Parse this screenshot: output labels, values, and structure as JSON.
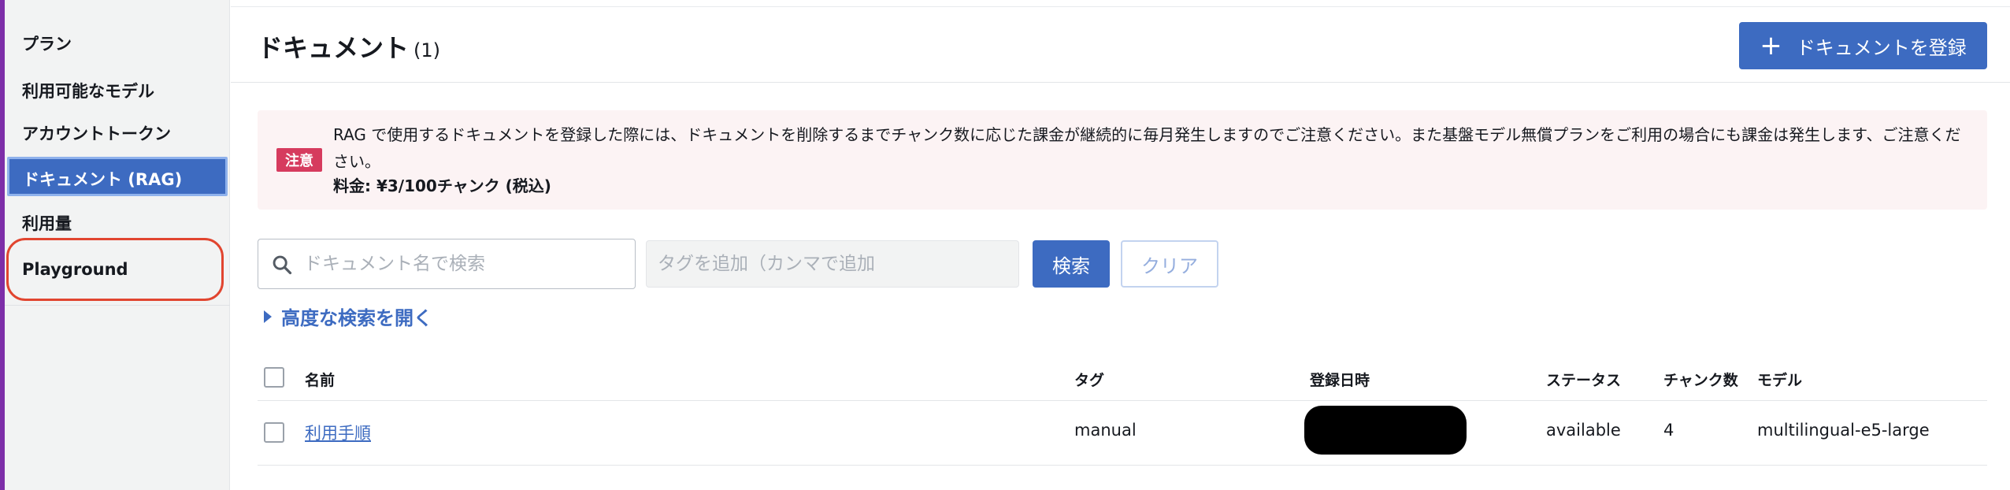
{
  "sidebar": {
    "items": [
      {
        "label": "プラン"
      },
      {
        "label": "利用可能なモデル"
      },
      {
        "label": "アカウントトークン"
      },
      {
        "label": "ドキュメント (RAG)",
        "active": true
      },
      {
        "label": "利用量"
      },
      {
        "label": "Playground",
        "highlighted": true
      }
    ]
  },
  "header": {
    "title": "ドキュメント",
    "count": "(1)",
    "register_label": "ドキュメントを登録",
    "register_icon": "plus-icon"
  },
  "notice": {
    "badge": "注意",
    "text": "RAG で使用するドキュメントを登録した際には、ドキュメントを削除するまでチャンク数に応じた課金が継続的に毎月発生しますのでご注意ください。また基盤モデル無償プランをご利用の場合にも課金は発生します、ご注意ください。",
    "price": "料金: ¥3/100チャンク (税込)"
  },
  "search": {
    "placeholder": "ドキュメント名で検索",
    "value": "",
    "tag_placeholder": "タグを追加（カンマで追加",
    "search_label": "検索",
    "clear_label": "クリア",
    "advanced_label": "高度な検索を開く"
  },
  "table": {
    "columns": [
      "名前",
      "タグ",
      "登録日時",
      "ステータス",
      "チャンク数",
      "モデル"
    ],
    "rows": [
      {
        "name": "利用手順",
        "tag": "manual",
        "status": "available",
        "chunks": "4",
        "model": "multilingual-e5-large"
      }
    ]
  },
  "colors": {
    "primary": "#3d6bc1",
    "badge": "#d63b5e",
    "notice_bg": "#fcf3f4",
    "highlight_ring": "#e1452f",
    "sidebar_bg": "#f2f3f3"
  }
}
